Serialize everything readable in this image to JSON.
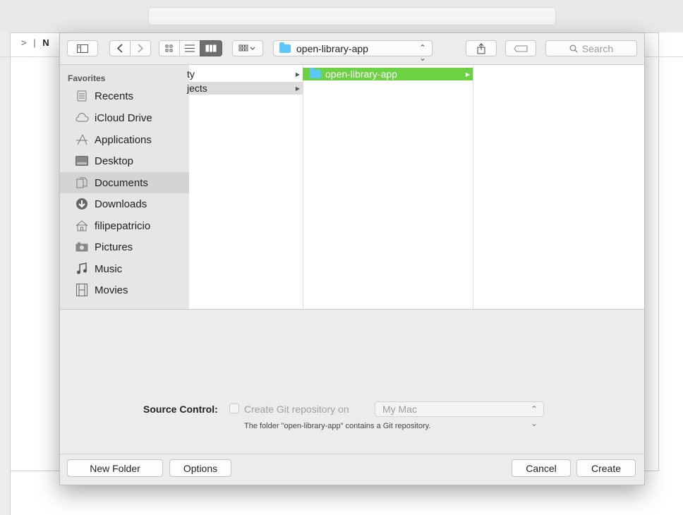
{
  "background": {
    "breadcrumb_chevron": ">",
    "breadcrumb_sep": "|",
    "breadcrumb_partial": "N"
  },
  "toolbar": {
    "sidebar_toggle_icon": "sidebar-icon",
    "back_icon": "chevron-left-icon",
    "forward_icon": "chevron-right-icon",
    "view_icons": [
      "icon-view-icon",
      "list-view-icon",
      "column-view-icon",
      "gallery-view-icon"
    ],
    "path_folder": "open-library-app",
    "share_icon": "share-icon",
    "tag_icon": "tag-icon",
    "search_placeholder": "Search"
  },
  "sidebar": {
    "section": "Favorites",
    "items": [
      {
        "label": "Recents",
        "icon": "recents-icon"
      },
      {
        "label": "iCloud Drive",
        "icon": "cloud-icon"
      },
      {
        "label": "Applications",
        "icon": "applications-icon"
      },
      {
        "label": "Desktop",
        "icon": "desktop-icon"
      },
      {
        "label": "Documents",
        "icon": "documents-icon",
        "selected": true
      },
      {
        "label": "Downloads",
        "icon": "downloads-icon"
      },
      {
        "label": "filipepatricio",
        "icon": "home-icon"
      },
      {
        "label": "Pictures",
        "icon": "camera-icon"
      },
      {
        "label": "Music",
        "icon": "music-icon"
      },
      {
        "label": "Movies",
        "icon": "movies-icon"
      }
    ]
  },
  "columns": {
    "col1": [
      {
        "label": "ty",
        "has_children": true
      },
      {
        "label": "jects",
        "has_children": true,
        "selected": true
      }
    ],
    "col2": [
      {
        "label": "open-library-app",
        "has_children": true,
        "selected": true
      }
    ]
  },
  "source_control": {
    "label": "Source Control:",
    "checkbox_label": "Create Git repository on",
    "location": "My Mac",
    "note": "The folder \"open-library-app\" contains a Git repository."
  },
  "buttons": {
    "new_folder": "New Folder",
    "options": "Options",
    "cancel": "Cancel",
    "create": "Create"
  },
  "colors": {
    "selection_green": "#6cd243",
    "folder_blue": "#5ac8fa"
  }
}
